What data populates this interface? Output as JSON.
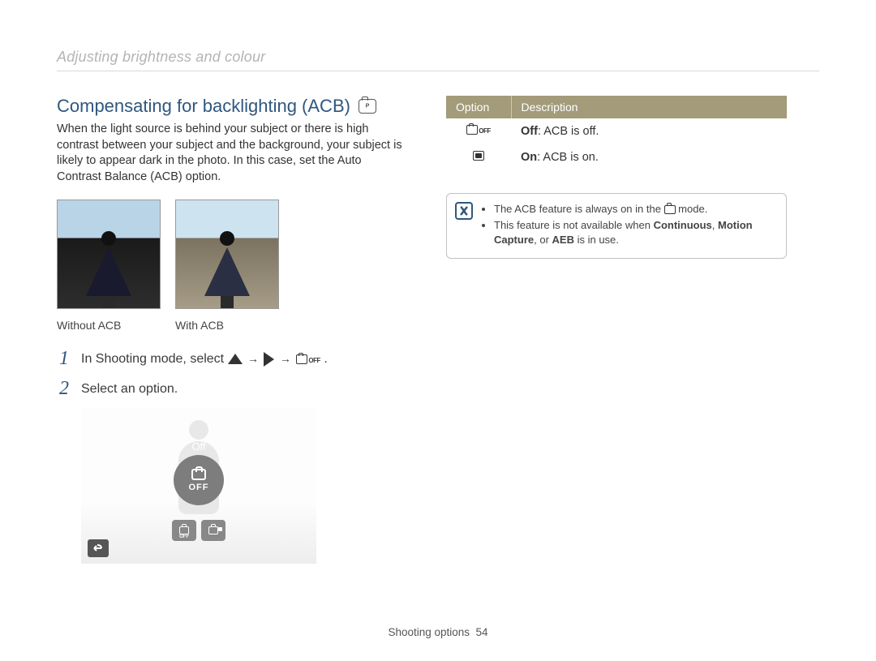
{
  "breadcrumb": "Adjusting brightness and colour",
  "section": {
    "title": "Compensating for backlighting (ACB)",
    "mode_icon": "camera-program-mode-icon",
    "body": "When the light source is behind your subject or there is high contrast between your subject and the background, your subject is likely to appear dark in the photo. In this case, set the Auto Contrast Balance (ACB) option."
  },
  "photos": {
    "left_caption": "Without ACB",
    "right_caption": "With ACB"
  },
  "steps": [
    {
      "num": "1",
      "text_prefix": "In Shooting mode, select ",
      "seq_end": "."
    },
    {
      "num": "2",
      "text": "Select an option."
    }
  ],
  "step1_icons": {
    "arrow": "→"
  },
  "ui_screenshot": {
    "label": "Off",
    "badge_text": "OFF",
    "mini_off_label": "OFF"
  },
  "option_table": {
    "headers": {
      "option": "Option",
      "description": "Description"
    },
    "rows": [
      {
        "icon": "acb-off-icon",
        "desc_bold": "Off",
        "desc_rest": ": ACB is off."
      },
      {
        "icon": "acb-on-icon",
        "desc_bold": "On",
        "desc_rest": ": ACB is on."
      }
    ]
  },
  "note": {
    "bullets": [
      {
        "pre": "The ACB feature is always on in the ",
        "mode_inline": true,
        "post": " mode."
      },
      {
        "pre": "This feature is not available when ",
        "bold1": "Continuous",
        "mid": ", ",
        "bold2": "Motion Capture",
        "post": ", or ",
        "bold3": "AEB",
        "tail": " is in use."
      }
    ]
  },
  "footer": {
    "section": "Shooting options",
    "page": "54"
  }
}
